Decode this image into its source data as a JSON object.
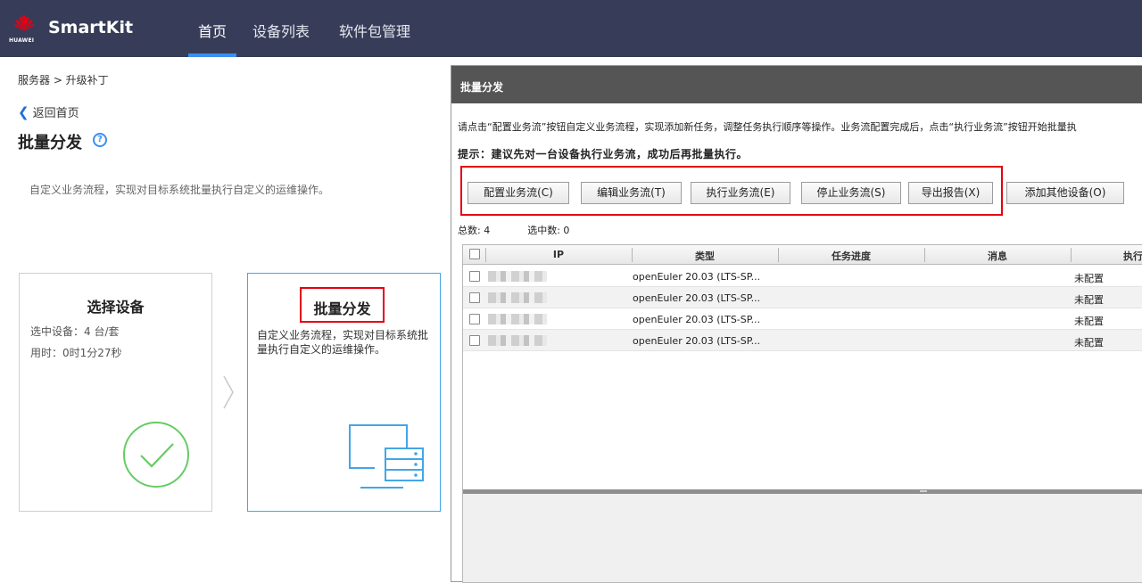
{
  "brand": {
    "logo_text": "HUAWEI",
    "app_name": "SmartKit",
    "logo_color": "#e60012"
  },
  "nav": {
    "items": [
      {
        "label": "首页",
        "active": true
      },
      {
        "label": "设备列表"
      },
      {
        "label": "软件包管理"
      }
    ]
  },
  "colors": {
    "topbar": "#373d58",
    "accent": "#3b8ff2",
    "highlight_box": "#e60012",
    "success": "#66cc66"
  },
  "page": {
    "breadcrumb": "服务器 > 升级补丁",
    "back_label": "返回首页",
    "title": "批量分发",
    "description": "自定义业务流程，实现对目标系统批量执行自定义的运维操作。"
  },
  "steps": {
    "select": {
      "title": "选择设备",
      "selected": "选中设备：4 台/套",
      "elapsed": "用时：0时1分27秒",
      "icon": "check-circle-icon"
    },
    "distribute": {
      "title": "批量分发",
      "desc": "自定义业务流程，实现对目标系统批量执行自定义的运维操作。",
      "icon": "server-monitor-icon"
    }
  },
  "dialog": {
    "title": "批量分发",
    "info": "请点击“配置业务流”按钮自定义业务流程，实现添加新任务，调整任务执行顺序等操作。业务流配置完成后，点击“执行业务流”按钮开始批量执",
    "tip": "提示：建议先对一台设备执行业务流，成功后再批量执行。",
    "buttons": [
      "配置业务流(C)",
      "编辑业务流(T)",
      "执行业务流(E)",
      "停止业务流(S)",
      "导出报告(X)",
      "添加其他设备(O)"
    ],
    "total": "总数: 4",
    "selected": "选中数: 0",
    "columns": [
      "IP",
      "类型",
      "任务进度",
      "消息",
      "执行"
    ],
    "rows": [
      {
        "type": "openEuler 20.03 (LTS-SP...",
        "exec": "未配置"
      },
      {
        "type": "openEuler 20.03 (LTS-SP...",
        "exec": "未配置"
      },
      {
        "type": "openEuler 20.03 (LTS-SP...",
        "exec": "未配置"
      },
      {
        "type": "openEuler 20.03 (LTS-SP...",
        "exec": "未配置"
      }
    ]
  }
}
